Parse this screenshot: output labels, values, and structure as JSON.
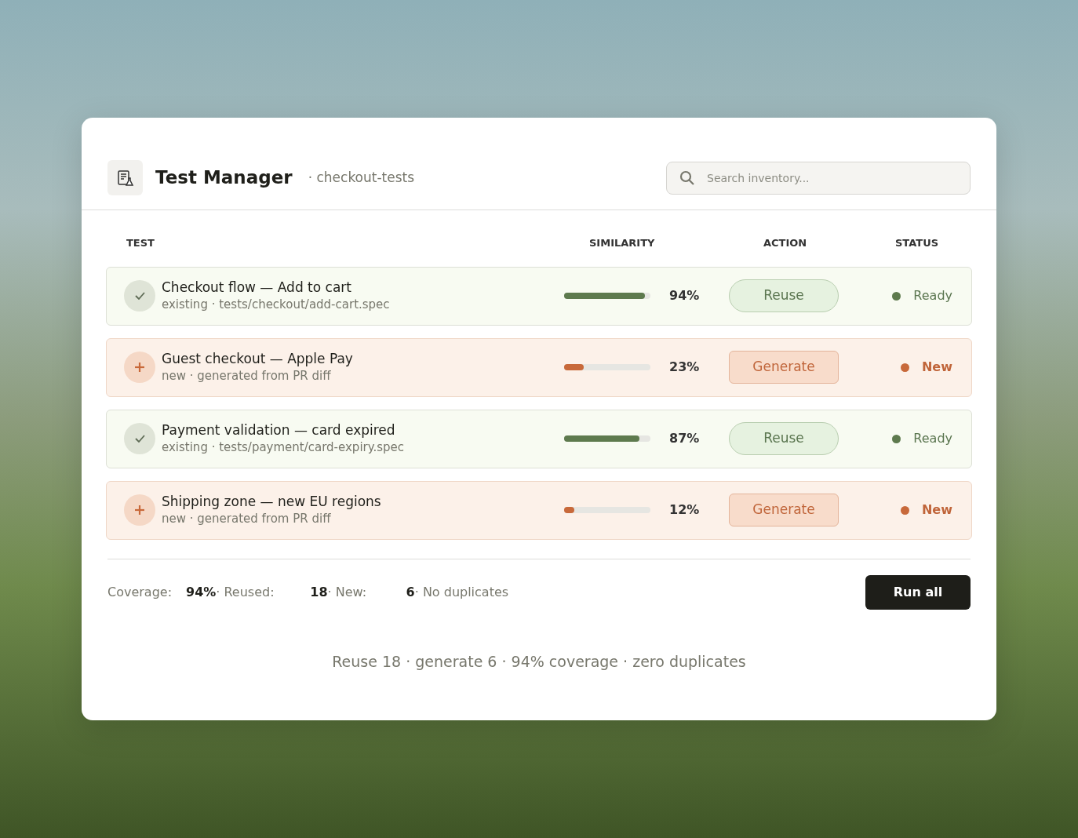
{
  "header": {
    "title": "Test Manager",
    "subtitle": "· checkout-tests",
    "search": {
      "placeholder": "Search inventory..."
    }
  },
  "columns": [
    "TEST",
    "SIMILARITY",
    "ACTION",
    "STATUS"
  ],
  "rows": [
    {
      "kind": "existing",
      "title": "Checkout flow — Add to cart",
      "detail": "existing · tests/checkout/add-cart.spec",
      "level": 0.94,
      "reading": "94%",
      "action": "Reuse",
      "status": "Ready"
    },
    {
      "kind": "new",
      "title": "Guest checkout — Apple Pay",
      "detail": "new · generated from PR diff",
      "level": 0.23,
      "reading": "23%",
      "action": "Generate",
      "status": "New"
    },
    {
      "kind": "existing",
      "title": "Payment validation — card expired",
      "detail": "existing · tests/payment/card-expiry.spec",
      "level": 0.87,
      "reading": "87%",
      "action": "Reuse",
      "status": "Ready"
    },
    {
      "kind": "new",
      "title": "Shipping zone — new EU regions",
      "detail": "new · generated from PR diff",
      "level": 0.12,
      "reading": "12%",
      "action": "Generate",
      "status": "New"
    }
  ],
  "summary": {
    "stats": [
      {
        "label": "Coverage:",
        "value": "94%"
      },
      {
        "label": "· Reused:",
        "value": "18"
      },
      {
        "label": "· New:",
        "value": "6"
      }
    ],
    "note": "· No duplicates",
    "button": "Run all"
  },
  "caption": "Reuse 18 · generate 6 · 94% coverage · zero duplicates"
}
